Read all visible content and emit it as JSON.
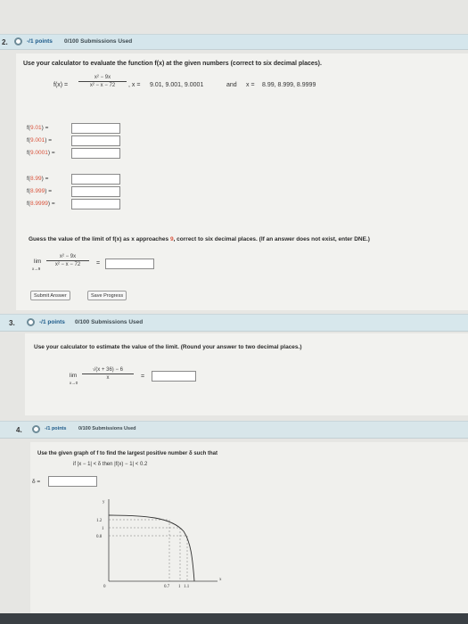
{
  "q2": {
    "number": "2.",
    "points": "-/1 points",
    "submissions": "0/100 Submissions Used",
    "prompt": "Use your calculator to evaluate the function f(x) at the given numbers (correct to six decimal places).",
    "function_label": "f(x) =",
    "numerator": "x² − 9x",
    "denominator": "x² − x − 72",
    "x_prefix1": ", x =",
    "x_values1": "9.01, 9.001, 9.0001",
    "and_text": "and",
    "x_prefix2": "x =",
    "x_values2": "8.99, 8.999, 8.9999",
    "rows": [
      {
        "pre": "f(",
        "val": "9.01",
        "post": ")  ="
      },
      {
        "pre": "f(",
        "val": "9.001",
        "post": ")  ="
      },
      {
        "pre": "f(",
        "val": "9.0001",
        "post": ") ="
      },
      {
        "pre": "f(",
        "val": "8.99",
        "post": ")  ="
      },
      {
        "pre": "f(",
        "val": "8.999",
        "post": ")  ="
      },
      {
        "pre": "f(",
        "val": "8.9999",
        "post": ") ="
      }
    ],
    "guess_part1": "Guess the value of the limit of f(x) as x approaches",
    "guess_val": "9",
    "guess_part2": ", correct to six decimal places. (If an answer does not exist, enter DNE.)",
    "lim_label": "lim",
    "lim_sub": "x→9",
    "lim_num": "x² − 9x",
    "lim_den": "x² − x − 72",
    "equals": "=",
    "submit_label": "Submit Answer",
    "save_label": "Save Progress"
  },
  "q3": {
    "number": "3.",
    "points": "-/1 points",
    "submissions": "0/100 Submissions Used",
    "prompt": "Use your calculator to estimate the value of the limit. (Round your answer to two decimal places.)",
    "lim_label": "lim",
    "lim_sub": "x→0",
    "numerator": "√(x + 36) − 6",
    "denominator": "x",
    "equals": "="
  },
  "q4": {
    "number": "4.",
    "points": "-/1 points",
    "submissions": "0/100 Submissions Used",
    "prompt": "Use the given graph of f to find the largest positive number δ such that",
    "condition": "if  |x − 1| < δ   then   |f(x) − 1| < 0.2",
    "delta_label": "δ =",
    "graph": {
      "y_axis_label": "y",
      "x_axis_label": "x",
      "y_ticks": [
        "1.2",
        "1",
        "0.8"
      ],
      "x_ticks": [
        "0",
        "0.7",
        "1",
        "1.1"
      ]
    }
  }
}
